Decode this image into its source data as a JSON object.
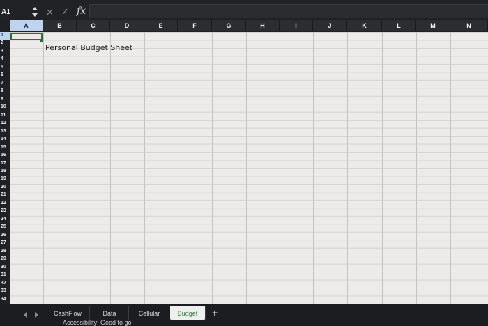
{
  "formula_bar": {
    "name_box": "A1",
    "fx_label": "fx",
    "formula": ""
  },
  "columns": [
    "A",
    "B",
    "C",
    "D",
    "E",
    "F",
    "G",
    "H",
    "I",
    "J",
    "K",
    "L",
    "M",
    "N"
  ],
  "rows": [
    "1",
    "2",
    "3",
    "4",
    "5",
    "6",
    "7",
    "8",
    "9",
    "10",
    "11",
    "12",
    "13",
    "14",
    "15",
    "16",
    "17",
    "18",
    "19",
    "20",
    "21",
    "22",
    "23",
    "24",
    "25",
    "26",
    "27",
    "28",
    "29",
    "30",
    "31",
    "32",
    "33",
    "34"
  ],
  "cells": {
    "B2": "Personal Budget Sheet"
  },
  "sheet_tabs": [
    {
      "label": "CashFlow",
      "active": false
    },
    {
      "label": "Data",
      "active": false
    },
    {
      "label": "Cellular",
      "active": false
    },
    {
      "label": "Budget",
      "active": true
    }
  ],
  "add_sheet_label": "+",
  "status_bar": {
    "text": "Accessibility: Good to go"
  },
  "colors": {
    "active_cell_border": "#2a6e3c",
    "header_background": "#1f2125",
    "grid_background": "#ecebea"
  }
}
